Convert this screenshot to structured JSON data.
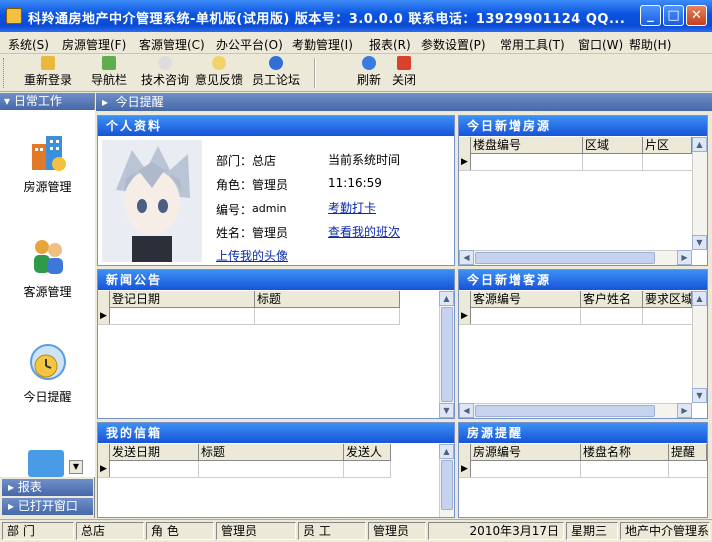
{
  "window": {
    "title": "科羚通房地产中介管理系统-单机版(试用版) 版本号：3.0.0.0 联系电话：13929901124 QQ...",
    "controls": [
      "_",
      "□",
      "✕"
    ]
  },
  "menu": [
    "系统(S)",
    "房源管理(F)",
    "客源管理(C)",
    "办公平台(O)",
    "考勤管理(I)",
    "报表(R)",
    "参数设置(P)",
    "常用工具(T)",
    "窗口(W)",
    "帮助(H)"
  ],
  "toolbar": {
    "relogin": "重新登录",
    "navbar": "导航栏",
    "tech": "技术咨询",
    "feedback": "意见反馈",
    "forum": "员工论坛",
    "refresh": "刷新",
    "close": "关闭"
  },
  "sidebar": {
    "header": "日常工作",
    "items": [
      "房源管理",
      "客源管理",
      "今日提醒"
    ],
    "sections": [
      "报表",
      "已打开窗口"
    ]
  },
  "tab": {
    "label": "今日提醒"
  },
  "profile": {
    "title": "个人资料",
    "dept_label": "部门：",
    "dept": "总店",
    "role_label": "角色：",
    "role": "管理员",
    "id_label": "编号：",
    "id": "admin",
    "name_label": "姓名：",
    "name": "管理员",
    "time_label": "当前系统时间",
    "time": "11:16:59",
    "checkin": "考勤打卡",
    "schedule": "查看我的班次",
    "upload": "上传我的头像"
  },
  "panels": {
    "new_houses": {
      "title": "今日新增房源",
      "cols": [
        "楼盘编号",
        "区域",
        "片区"
      ]
    },
    "news": {
      "title": "新闻公告",
      "cols": [
        "登记日期",
        "标题"
      ]
    },
    "new_clients": {
      "title": "今日新增客源",
      "cols": [
        "客源编号",
        "客户姓名",
        "要求区域"
      ]
    },
    "mailbox": {
      "title": "我的信箱",
      "cols": [
        "发送日期",
        "标题",
        "发送人"
      ]
    },
    "house_reminders": {
      "title": "房源提醒",
      "cols": [
        "房源编号",
        "楼盘名称",
        "提醒"
      ]
    }
  },
  "statusbar": {
    "dept_label": "部  门",
    "dept": "总店",
    "role_label": "角  色",
    "role": "管理员",
    "staff_label": "员  工",
    "staff": "管理员",
    "date": "2010年3月17日",
    "weekday": "星期三",
    "app": "地产中介管理系"
  },
  "colors": {
    "accent": "#1653d8",
    "title_bar": "#0a53e0"
  }
}
